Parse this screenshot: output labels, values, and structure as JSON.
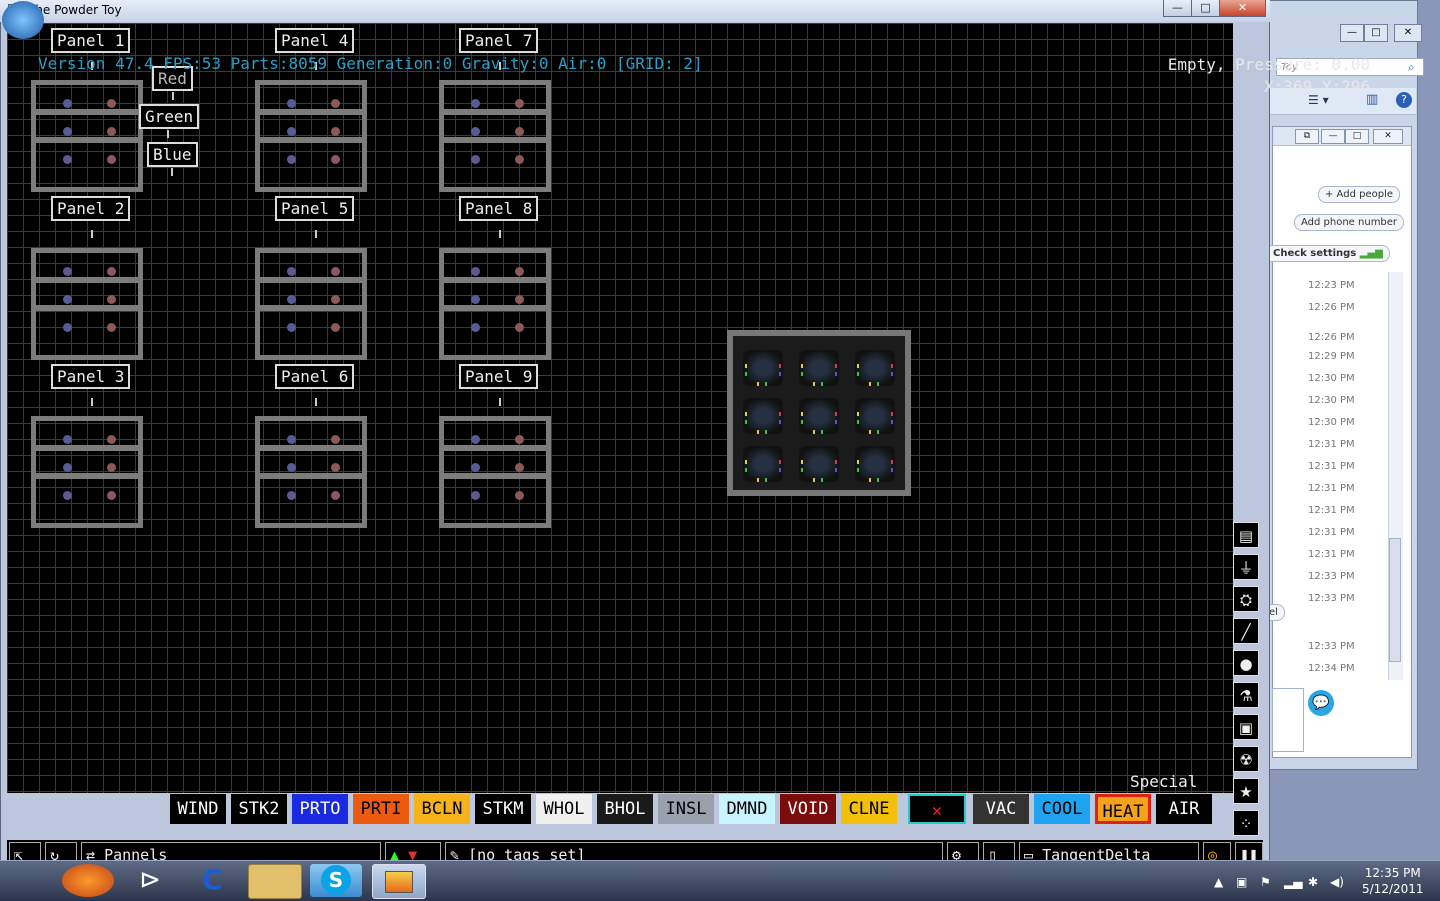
{
  "window": {
    "title": "The Powder Toy",
    "controls": {
      "minimize": "—",
      "maximize": "□",
      "close": "✕"
    }
  },
  "hud": {
    "left": "Version 47.4 FPS:53 Parts:8059 Generation:0 Gravity:0 Air:0 [GRID: 2]",
    "status": "Empty, Pressure: 0.00",
    "coords": "X:369 Y:296"
  },
  "panels": [
    {
      "label": "Panel 1"
    },
    {
      "label": "Panel 2"
    },
    {
      "label": "Panel 3"
    },
    {
      "label": "Panel 4"
    },
    {
      "label": "Panel 5"
    },
    {
      "label": "Panel 6"
    },
    {
      "label": "Panel 7"
    },
    {
      "label": "Panel 8"
    },
    {
      "label": "Panel 9"
    }
  ],
  "color_labels": [
    "Red",
    "Green",
    "Blue"
  ],
  "toolbar": {
    "section": "Special",
    "elements": [
      {
        "label": "WIND",
        "bg": "#000000",
        "fg": "#ffffff"
      },
      {
        "label": "STK2",
        "bg": "#000000",
        "fg": "#ffffff"
      },
      {
        "label": "PRTO",
        "bg": "#1a2ae0",
        "fg": "#ffffff"
      },
      {
        "label": "PRTI",
        "bg": "#ec5a10",
        "fg": "#000000"
      },
      {
        "label": "BCLN",
        "bg": "#f5b21a",
        "fg": "#000000"
      },
      {
        "label": "STKM",
        "bg": "#000000",
        "fg": "#ffffff"
      },
      {
        "label": "WHOL",
        "bg": "#f0f0f0",
        "fg": "#000000"
      },
      {
        "label": "BHOL",
        "bg": "#1a1a1a",
        "fg": "#ffffff"
      },
      {
        "label": "INSL",
        "bg": "#9aa0ac",
        "fg": "#000000"
      },
      {
        "label": "DMND",
        "bg": "#c8f4ff",
        "fg": "#000000"
      },
      {
        "label": "VOID",
        "bg": "#7a0c0c",
        "fg": "#ffffff"
      },
      {
        "label": "CLNE",
        "bg": "#f2c00a",
        "fg": "#000000"
      },
      {
        "label": "✕",
        "bg": "#000000",
        "fg": "#ee2222"
      },
      {
        "label": "VAC",
        "bg": "#333333",
        "fg": "#ffffff"
      },
      {
        "label": "COOL",
        "bg": "#1fa3f0",
        "fg": "#000000"
      },
      {
        "label": "HEAT",
        "bg": "#f5a21a",
        "fg": "#000000"
      },
      {
        "label": "AIR",
        "bg": "#000000",
        "fg": "#ffffff"
      }
    ],
    "categories": [
      "wall-icon",
      "electronics-icon",
      "powders-icon",
      "solids-icon",
      "liquids-icon",
      "gases-icon",
      "explosives-icon",
      "radioactive-icon",
      "special-icon",
      "particles-icon",
      "pause-icon"
    ]
  },
  "bottombar": {
    "save_name": "Pannels",
    "tags": "[no tags set]",
    "user": "TangentDelta"
  },
  "chat": {
    "search_placeholder": "Toy",
    "add_people": "+ Add people",
    "add_phone": "Add phone number",
    "check_settings": "Check settings",
    "times": [
      "12:23 PM",
      "12:26 PM",
      "12:26 PM",
      "12:29 PM",
      "12:30 PM",
      "12:30 PM",
      "12:30 PM",
      "12:31 PM",
      "12:31 PM",
      "12:31 PM",
      "12:31 PM",
      "12:31 PM",
      "12:31 PM",
      "12:33 PM",
      "12:33 PM",
      "12:33 PM",
      "12:34 PM"
    ],
    "partial": "el"
  },
  "taskbar": {
    "time": "12:35 PM",
    "date": "5/12/2011"
  }
}
